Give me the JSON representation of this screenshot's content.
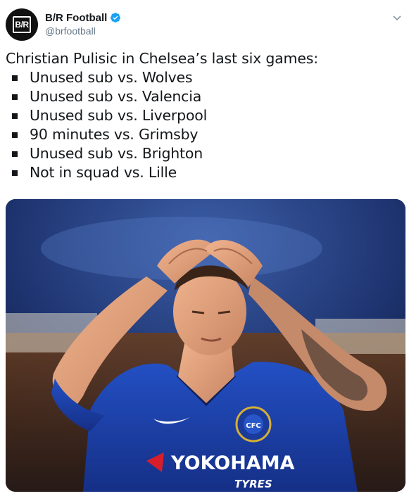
{
  "account": {
    "display_name": "B/R Football",
    "handle": "@brfootball",
    "avatar_text": "B/R",
    "verified_icon": "verified-badge-icon"
  },
  "tweet": {
    "intro": "Christian Pulisic in Chelsea’s last six games:",
    "items": [
      "Unused sub vs. Wolves",
      "Unused sub vs. Valencia",
      "Unused sub vs. Liverpool",
      "90 minutes vs. Grimsby",
      "Unused sub vs. Brighton",
      "Not in squad vs. Lille"
    ]
  },
  "photo": {
    "sponsor": "YOKOHAMA",
    "sponsor_sub": "TYRES",
    "crest": "CHELSEA FOOTBALL CLUB"
  },
  "colors": {
    "verified": "#1da1f2",
    "text": "#14171a",
    "muted": "#657786",
    "jersey": "#1b3fa6"
  }
}
